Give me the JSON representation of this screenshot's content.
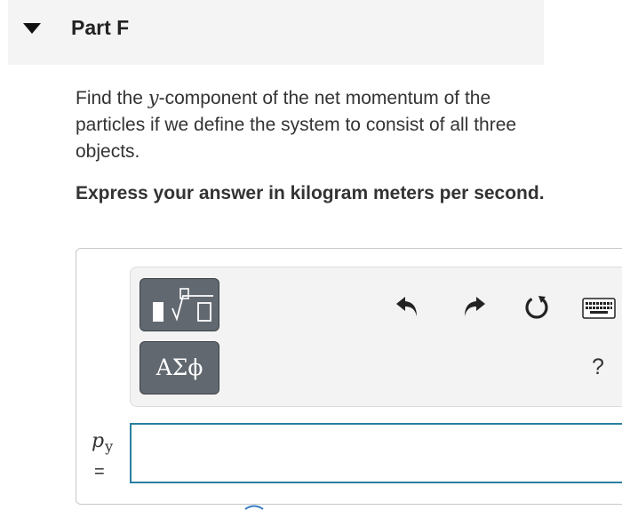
{
  "part": {
    "title": "Part F"
  },
  "question": {
    "text_before": "Find the ",
    "variable": "y",
    "text_after": "-component of the net momentum of the particles if we define the system to consist of all three objects."
  },
  "instruction": "Express your answer in kilogram meters per second.",
  "toolbar": {
    "symbols_label": "ΑΣϕ",
    "help_label": "?",
    "icons": [
      "templates-icon",
      "undo-icon",
      "redo-icon",
      "reset-icon",
      "keyboard-icon"
    ]
  },
  "answer": {
    "variable": "p",
    "subscript": "y",
    "equals": "=",
    "value": ""
  },
  "colors": {
    "header_bg": "#f4f4f4",
    "button_bg": "#616870",
    "input_border": "#2a7f9e",
    "text": "#333333"
  }
}
